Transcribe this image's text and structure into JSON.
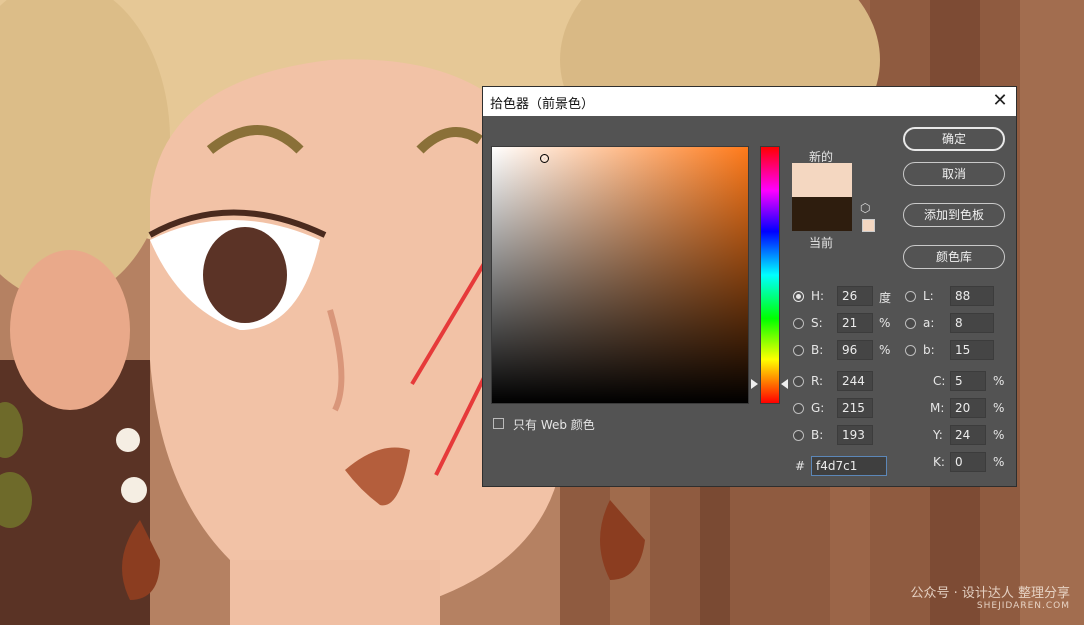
{
  "dialog": {
    "title": "拾色器（前景色）",
    "close": "✕"
  },
  "swatches": {
    "new_label": "新的",
    "current_label": "当前",
    "new_color": "#f4d7c1",
    "current_color": "#2e1d0e"
  },
  "buttons": {
    "ok": "确定",
    "cancel": "取消",
    "add_to_swatches": "添加到色板",
    "color_libraries": "颜色库"
  },
  "web_only": {
    "label": "只有 Web 颜色",
    "checked": false
  },
  "fields": {
    "H": {
      "label": "H:",
      "value": "26",
      "unit": "度",
      "selected": true
    },
    "S": {
      "label": "S:",
      "value": "21",
      "unit": "%"
    },
    "Bri": {
      "label": "B:",
      "value": "96",
      "unit": "%"
    },
    "R": {
      "label": "R:",
      "value": "244"
    },
    "G": {
      "label": "G:",
      "value": "215"
    },
    "Blue": {
      "label": "B:",
      "value": "193"
    },
    "L": {
      "label": "L:",
      "value": "88"
    },
    "a": {
      "label": "a:",
      "value": "8"
    },
    "b": {
      "label": "b:",
      "value": "15"
    },
    "C": {
      "label": "C:",
      "value": "5",
      "unit": "%"
    },
    "M": {
      "label": "M:",
      "value": "20",
      "unit": "%"
    },
    "Y": {
      "label": "Y:",
      "value": "24",
      "unit": "%"
    },
    "K": {
      "label": "K:",
      "value": "0",
      "unit": "%"
    },
    "hex": {
      "label": "#",
      "value": "f4d7c1"
    }
  },
  "colors": {
    "dialog_bg": "#535353",
    "annotation_red": "#e63a3a",
    "hue_base": "#ff7a1a"
  },
  "watermark": {
    "main": "公众号 · 设计达人 整理分享",
    "sub": "SHEJIDAREN.COM"
  }
}
